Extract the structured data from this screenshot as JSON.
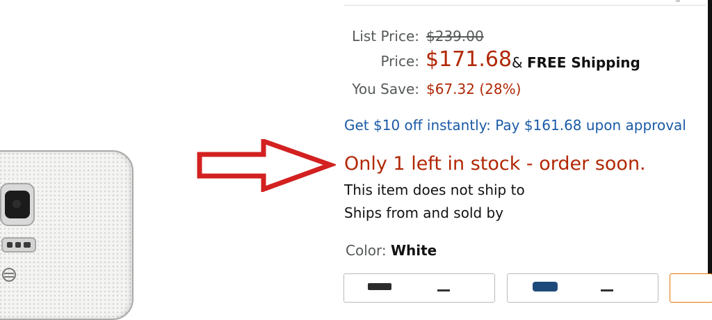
{
  "pricing": {
    "list_price_label": "List Price:",
    "list_price": "$239.00",
    "price_label": "Price:",
    "price": "$171.68",
    "shipping_connector": "&",
    "shipping_text": "FREE Shipping",
    "you_save_label": "You Save:",
    "you_save": "$67.32 (28%)"
  },
  "promo": {
    "text": "Get $10 off instantly: Pay $161.68 upon approval"
  },
  "availability": {
    "stock_message": "Only 1 left in stock - order soon.",
    "ship_to_text": "This item does not ship to",
    "ships_from_text": "Ships from and sold by"
  },
  "color_selector": {
    "label": "Color:",
    "selected": "White"
  },
  "annotation": {
    "arrow_color": "#d32020"
  },
  "colors": {
    "price_red": "#b12704",
    "link_blue": "#1a5aa6",
    "label_gray": "#565959"
  }
}
